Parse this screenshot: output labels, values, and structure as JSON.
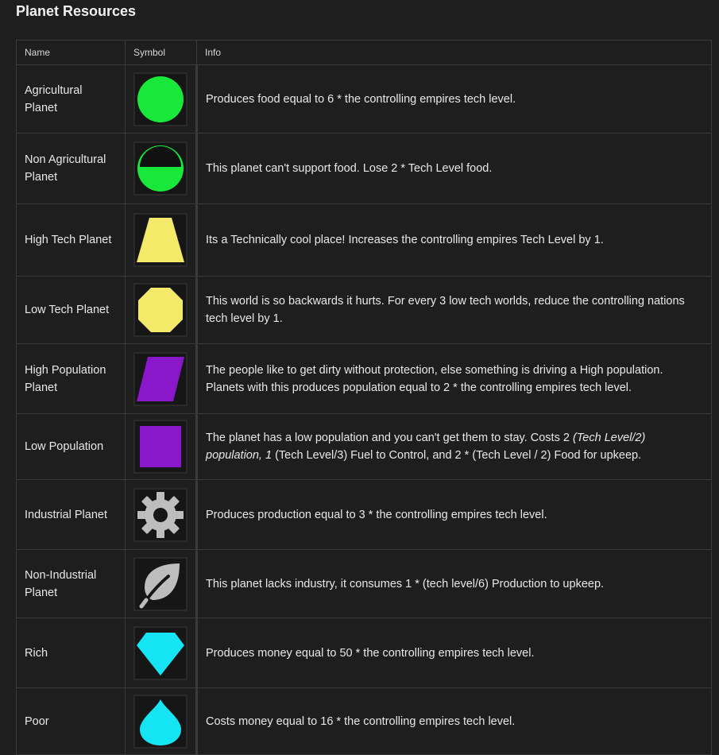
{
  "title": "Planet Resources",
  "columns": {
    "name": "Name",
    "symbol": "Symbol",
    "info": "Info"
  },
  "rows": [
    {
      "name": "Agricultural Planet",
      "icon": "green-circle-icon",
      "info": "Produces food equal to 6 * the controlling empires tech level."
    },
    {
      "name": "Non Agricultural Planet",
      "icon": "green-half-circle-icon",
      "info": "This planet can't support food. Lose 2 * Tech Level food."
    },
    {
      "name": "High Tech Planet",
      "icon": "yellow-trapezoid-icon",
      "info": "Its a Technically cool place! Increases the controlling empires Tech Level by 1."
    },
    {
      "name": "Low Tech Planet",
      "icon": "yellow-octagon-icon",
      "info": "This world is so backwards it hurts. For every 3 low tech worlds, reduce the controlling nations tech level by 1."
    },
    {
      "name": "High Population Planet",
      "icon": "purple-parallelogram-icon",
      "info": "The people like to get dirty without protection, else something is driving a High population. Planets with this produces population equal to 2 * the controlling empires tech level."
    },
    {
      "name": "Low Population",
      "icon": "purple-square-icon",
      "info_parts": [
        "The planet has a low population and you can't get them to stay. Costs 2 ",
        "(Tech Level/2) population, 1",
        " (Tech Level/3) Fuel to Control, and 2 * (Tech Level / 2) Food for upkeep."
      ]
    },
    {
      "name": "Industrial Planet",
      "icon": "gear-icon",
      "info": "Produces production equal to 3 * the controlling empires tech level."
    },
    {
      "name": "Non-Industrial Planet",
      "icon": "leaf-icon",
      "info": "This planet lacks industry, it consumes 1 * (tech level/6) Production to upkeep."
    },
    {
      "name": "Rich",
      "icon": "cyan-diamond-icon",
      "info": "Produces money equal to 50 * the controlling empires tech level."
    },
    {
      "name": "Poor",
      "icon": "cyan-drop-icon",
      "info": "Costs money equal to 16 * the controlling empires tech level."
    }
  ],
  "colors": {
    "green": "#17e83a",
    "yellow": "#f4ea6a",
    "purple": "#8a17c9",
    "gray": "#bdbdbd",
    "cyan": "#14e4f4"
  }
}
